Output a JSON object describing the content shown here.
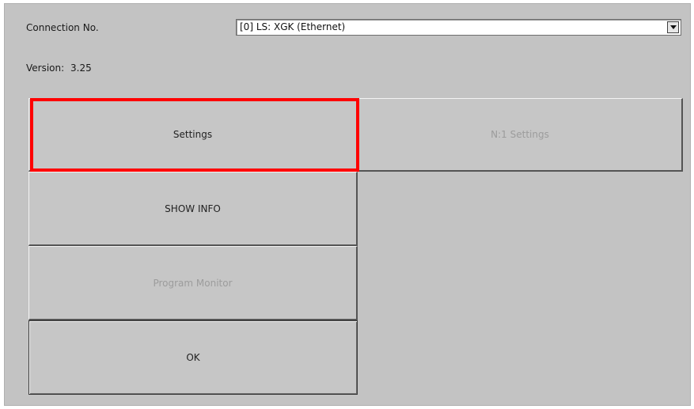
{
  "connection": {
    "label": "Connection No.",
    "selected_value": "[0] LS: XGK (Ethernet)"
  },
  "version": {
    "label": "Version:",
    "value": "3.25"
  },
  "buttons": {
    "settings": "Settings",
    "n1_settings": "N:1 Settings",
    "show_info": "SHOW INFO",
    "program_monitor": "Program Monitor",
    "ok": "OK"
  },
  "colors": {
    "panel_background": "#c3c3c3",
    "highlight": "#ff0000",
    "disabled_text": "#9c9c9c"
  }
}
